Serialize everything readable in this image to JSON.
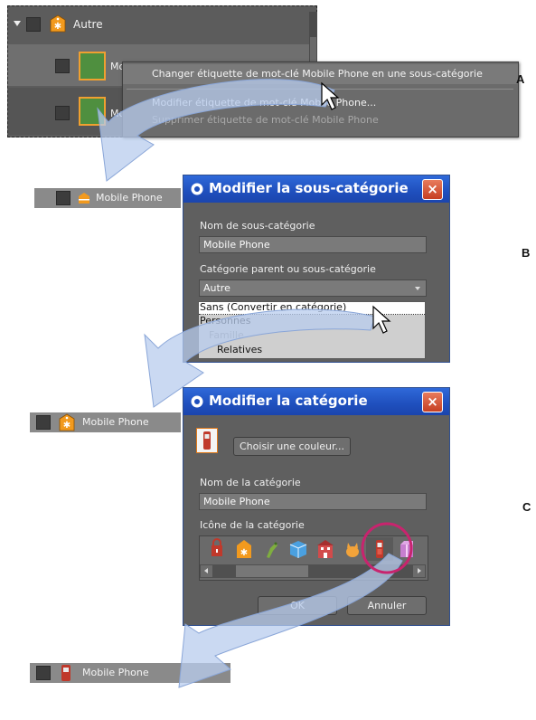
{
  "tag_panel": {
    "category_label": "Autre",
    "rows": [
      {
        "label": "Mobile Phone"
      },
      {
        "label": "Mobile Phone"
      }
    ]
  },
  "context_menu": {
    "items": [
      {
        "label": "Changer étiquette de mot-clé Mobile Phone en une sous-catégorie",
        "enabled": true
      },
      {
        "label": "Modifier étiquette de mot-clé Mobile Phone...",
        "enabled": true
      },
      {
        "label": "Supprimer étiquette de mot-clé Mobile Phone",
        "enabled": false
      }
    ]
  },
  "step_labels": {
    "a": "A",
    "b": "B",
    "c": "C"
  },
  "tag_bars": {
    "subcategory": {
      "label": "Mobile Phone",
      "icon": "subcategory-icon"
    },
    "category": {
      "label": "Mobile Phone",
      "icon": "category-star-icon"
    },
    "final": {
      "label": "Mobile Phone",
      "icon": "mobile-phone-icon"
    }
  },
  "dialog_subcategory": {
    "title": "Modifier la sous-catégorie",
    "name_label": "Nom de sous-catégorie",
    "name_value": "Mobile Phone",
    "parent_label": "Catégorie parent ou sous-catégorie",
    "parent_selected": "Autre",
    "dropdown_options": [
      {
        "label": "Sans (Convertir en catégorie)",
        "selected": true
      },
      {
        "label": "Personnes",
        "selected": false
      },
      {
        "label": "Famille",
        "selected": false
      },
      {
        "label": "Relatives",
        "selected": false
      }
    ]
  },
  "dialog_category": {
    "title": "Modifier la catégorie",
    "choose_color_label": "Choisir une couleur...",
    "name_label": "Nom de la catégorie",
    "name_value": "Mobile Phone",
    "icon_label": "Icône de la catégorie",
    "icons": [
      "lock-icon",
      "star-tag-icon",
      "parrot-icon",
      "cube-icon",
      "building-icon",
      "cat-icon",
      "mobile-phone-icon",
      "gift-icon"
    ],
    "selected_icon": "mobile-phone-icon",
    "ok_label": "OK",
    "cancel_label": "Annuler"
  },
  "colors": {
    "panel_bg": "#5c5c5c",
    "title_blue": "#1f4fbd",
    "highlight_circle": "#c8246e",
    "arrow_fill": "#b8ccee",
    "tag_orange": "#f29a1e"
  }
}
